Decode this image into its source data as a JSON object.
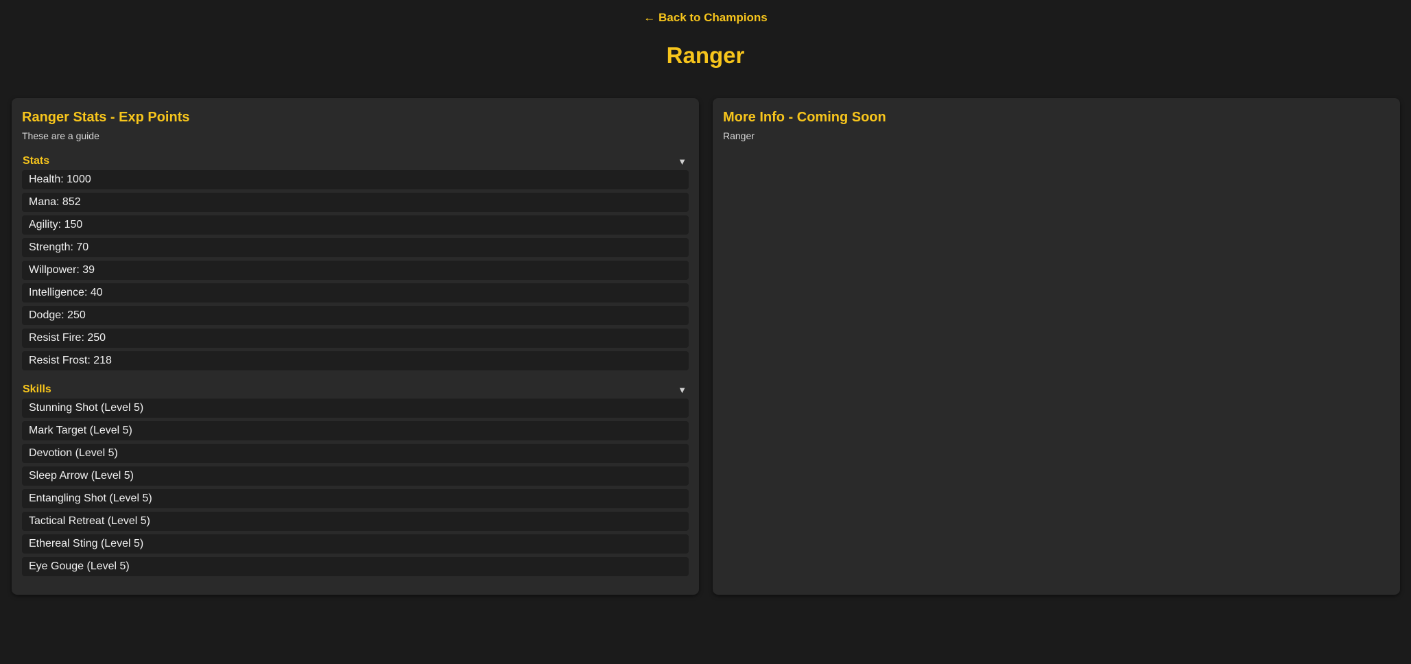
{
  "nav": {
    "back_label": "← Back to Champions"
  },
  "page": {
    "title": "Ranger"
  },
  "left_panel": {
    "heading": "Ranger Stats - Exp Points",
    "subtitle": "These are a guide",
    "stats_section": {
      "label": "Stats",
      "toggle_glyph": "▼",
      "items": [
        "Health: 1000",
        "Mana: 852",
        "Agility: 150",
        "Strength: 70",
        "Willpower: 39",
        "Intelligence: 40",
        "Dodge: 250",
        "Resist Fire: 250",
        "Resist Frost: 218"
      ]
    },
    "skills_section": {
      "label": "Skills",
      "toggle_glyph": "▼",
      "items": [
        "Stunning Shot (Level 5)",
        "Mark Target (Level 5)",
        "Devotion (Level 5)",
        "Sleep Arrow (Level 5)",
        "Entangling Shot (Level 5)",
        "Tactical Retreat (Level 5)",
        "Ethereal Sting (Level 5)",
        "Eye Gouge (Level 5)"
      ]
    }
  },
  "right_panel": {
    "heading": "More Info - Coming Soon",
    "subtitle": "Ranger"
  },
  "colors": {
    "accent": "#f7c51c",
    "background": "#1b1b1b",
    "panel": "#2a2a2a",
    "item": "#1e1e1e"
  }
}
